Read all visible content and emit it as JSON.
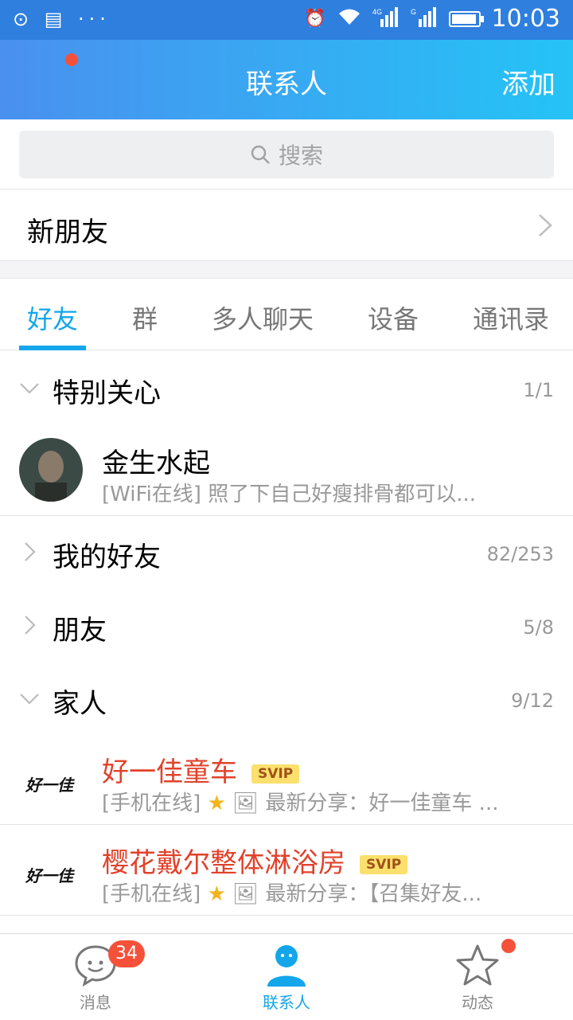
{
  "statusbar": {
    "left_icons": "⊙ ▤ ···",
    "network_4g": "4G",
    "network_g": "G",
    "time": "10:03"
  },
  "header": {
    "title": "联系人",
    "add_label": "添加"
  },
  "search": {
    "placeholder": "搜索"
  },
  "new_friend": {
    "label": "新朋友"
  },
  "tabs": [
    "好友",
    "群",
    "多人聊天",
    "设备",
    "通讯录"
  ],
  "groups": {
    "special": {
      "name": "特别关心",
      "count": "1/1"
    },
    "my_friends": {
      "name": "我的好友",
      "count": "82/253"
    },
    "friends": {
      "name": "朋友",
      "count": "5/8"
    },
    "family": {
      "name": "家人",
      "count": "9/12"
    }
  },
  "contacts": {
    "c1": {
      "name": "金生水起",
      "status": "[WiFi在线] 照了下自己好瘦排骨都可以..."
    },
    "c2": {
      "name": "好一佳童车",
      "badge": "SVIP",
      "status_prefix": "[手机在线]",
      "status": "最新分享：好一佳童车 ...",
      "logo": "好一佳"
    },
    "c3": {
      "name": "樱花戴尔整体淋浴房",
      "badge": "SVIP",
      "status_prefix": "[手机在线]",
      "status": "最新分享：【召集好友...",
      "logo": "好一佳"
    }
  },
  "tabbar": {
    "messages": {
      "label": "消息",
      "badge": "34"
    },
    "contacts": {
      "label": "联系人"
    },
    "moments": {
      "label": "动态"
    }
  },
  "colors": {
    "accent": "#13a6ea",
    "header_start": "#4a90ef",
    "header_end": "#25c3f6",
    "badge_red": "#f5513a",
    "vip_name": "#e2422b"
  }
}
